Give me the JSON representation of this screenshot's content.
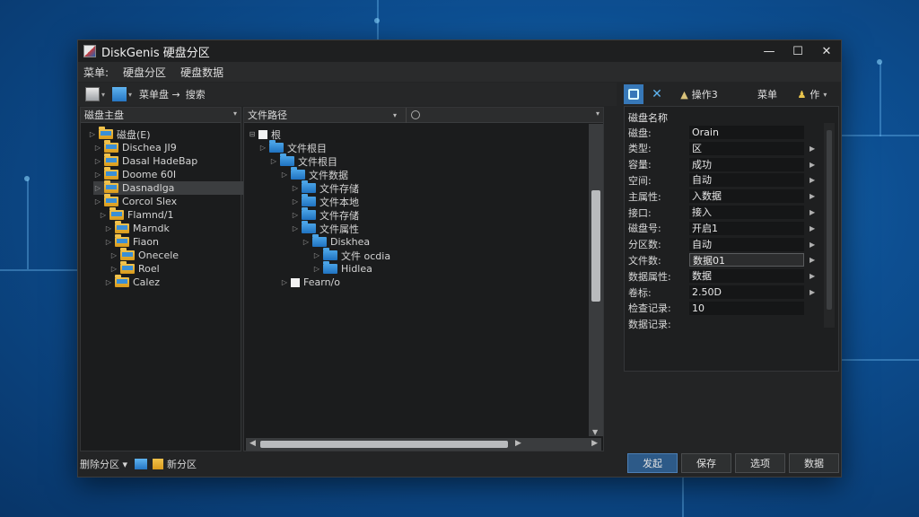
{
  "window": {
    "title": "DiskGenis 硬盘分区",
    "controls": [
      "—",
      "☐",
      "✕"
    ]
  },
  "menu": [
    "菜单:",
    "硬盘分区",
    "硬盘数据"
  ],
  "toolbar": {
    "item1_label": "菜单盘 →",
    "item2_label": "搜索"
  },
  "left_pane": {
    "header": "磁盘主盘",
    "tree": [
      {
        "label": "磁盘(E)",
        "depth": 0,
        "icon": "yellow"
      },
      {
        "label": "Disch​ea JI9",
        "depth": 1,
        "icon": "yellow"
      },
      {
        "label": "Dasal HadeBap",
        "depth": 1,
        "icon": "yellow"
      },
      {
        "label": "Doome 60I",
        "depth": 1,
        "icon": "yellow"
      },
      {
        "label": "Dasnadlga",
        "depth": 1,
        "icon": "yellow",
        "selected": true
      },
      {
        "label": "Corcol Slex",
        "depth": 1,
        "icon": "yellow"
      },
      {
        "label": "Flamnd/1",
        "depth": 2,
        "icon": "yellow"
      },
      {
        "label": "Marndk",
        "depth": 3,
        "icon": "yellow"
      },
      {
        "label": "Fiaon",
        "depth": 3,
        "icon": "yellow"
      },
      {
        "label": "Onecele",
        "depth": 4,
        "icon": "yellow"
      },
      {
        "label": "Roel",
        "depth": 4,
        "icon": "yellow"
      },
      {
        "label": "Calez",
        "depth": 3,
        "icon": "yellow"
      }
    ]
  },
  "middle_pane": {
    "header": "文件路径",
    "tree": [
      {
        "label": "根",
        "depth": 0,
        "icon": "none"
      },
      {
        "label": "文件根目",
        "depth": 1,
        "icon": "blue"
      },
      {
        "label": "文件根目",
        "depth": 2,
        "icon": "blue"
      },
      {
        "label": "文件数据",
        "depth": 3,
        "icon": "blue"
      },
      {
        "label": "文件存储",
        "depth": 4,
        "icon": "blue"
      },
      {
        "label": "文件本地",
        "depth": 4,
        "icon": "blue"
      },
      {
        "label": "文件存储",
        "depth": 4,
        "icon": "blue"
      },
      {
        "label": "文件属性",
        "depth": 4,
        "icon": "blue"
      },
      {
        "label": "Diskhea",
        "depth": 5,
        "icon": "blue"
      },
      {
        "label": "文件 ocdia",
        "depth": 6,
        "icon": "blue"
      },
      {
        "label": "Hidlea",
        "depth": 6,
        "icon": "blue"
      },
      {
        "label": "Fearn/o",
        "depth": 3,
        "icon": "none"
      }
    ]
  },
  "right_tabs": {
    "op_label": "操作3",
    "t2": "菜单",
    "t3": "作"
  },
  "properties": {
    "header": "磁盘名称",
    "rows": [
      {
        "key": "磁盘:",
        "value": "Orain",
        "arrow": false
      },
      {
        "key": "类型:",
        "value": "区",
        "arrow": true
      },
      {
        "key": "容量:",
        "value": "成功",
        "arrow": true
      },
      {
        "key": "空间:",
        "value": "自动",
        "arrow": true
      },
      {
        "key": "主属性:",
        "value": "入数据",
        "arrow": true
      },
      {
        "key": "接口:",
        "value": "接入",
        "arrow": true
      },
      {
        "key": "磁盘号:",
        "value": "开启1",
        "arrow": true
      },
      {
        "key": "分区数:",
        "value": "自动",
        "arrow": true
      },
      {
        "key": "文件数:",
        "value": "数据01",
        "arrow": true,
        "highlight": true
      },
      {
        "key": "数据属性:",
        "value": "数据",
        "arrow": true
      },
      {
        "key": "卷标:",
        "value": "2.50D",
        "arrow": true
      },
      {
        "key": "检查记录:",
        "value": "10",
        "arrow": false
      },
      {
        "key": "数据记录:",
        "value": "",
        "arrow": false
      }
    ]
  },
  "status_bar": {
    "left_label": "删除分区 ▾",
    "right_label": "新分区"
  },
  "buttons": [
    "发起",
    "保存",
    "选项",
    "数据"
  ]
}
